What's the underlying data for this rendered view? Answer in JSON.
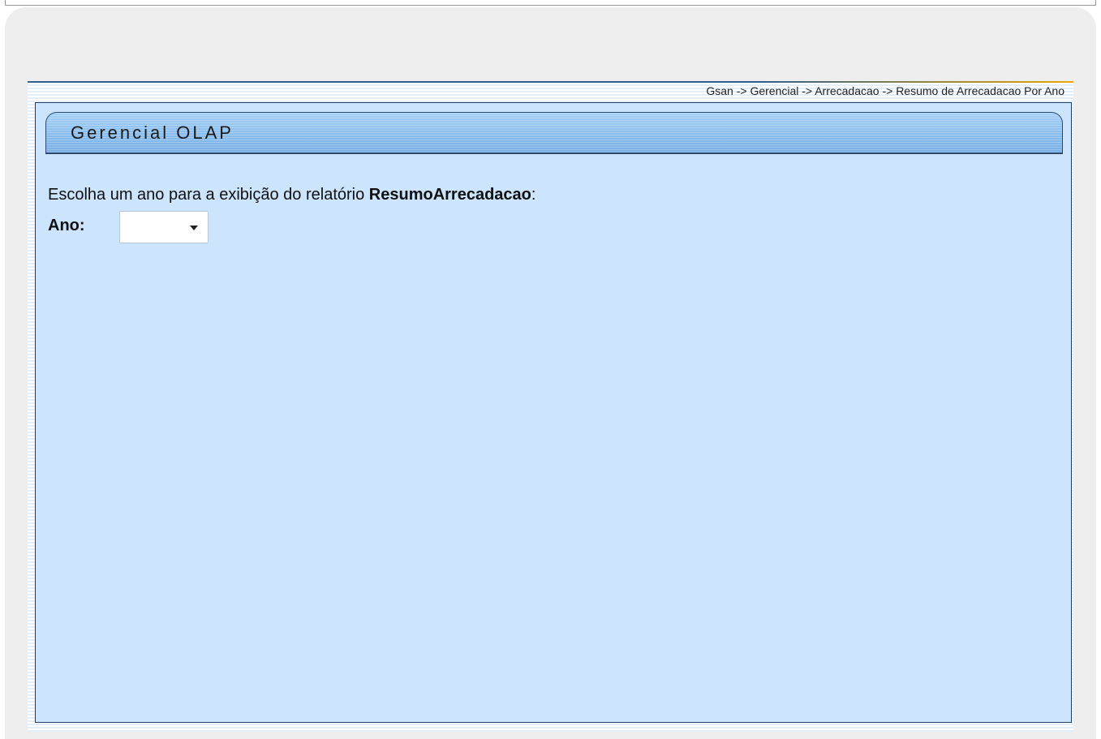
{
  "breadcrumb": {
    "text": "Gsan -> Gerencial -> Arrecadacao -> Resumo de Arrecadacao Por Ano"
  },
  "panel": {
    "title": "Gerencial OLAP"
  },
  "form": {
    "prompt_prefix": "Escolha um ano para a exibição do relatório ",
    "report_name": "ResumoArrecadacao",
    "prompt_suffix": ":",
    "year_label": "Ano:",
    "year_value": ""
  },
  "icons": {
    "dropdown": "chevron-down-icon"
  },
  "colors": {
    "content_background": "#cce4fc",
    "header_gradient_top": "#a6d0f6",
    "header_gradient_bottom": "#76aee6",
    "border_dark": "#1f3f66",
    "accent_line": "#e8a800"
  }
}
